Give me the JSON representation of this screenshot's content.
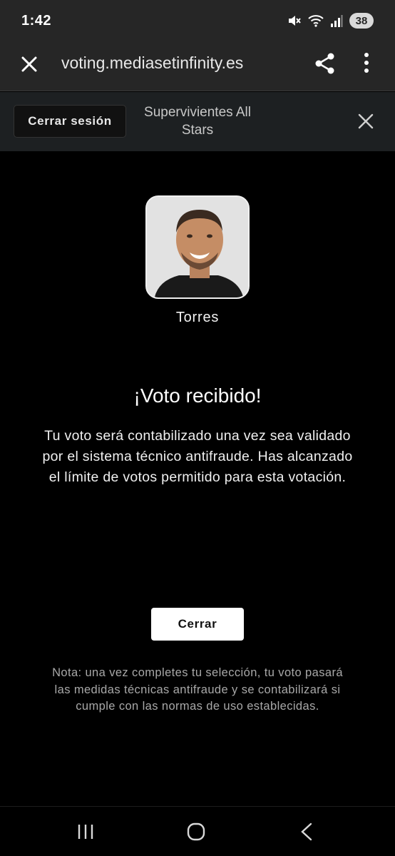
{
  "status_bar": {
    "time": "1:42",
    "icons": [
      "mute-icon",
      "wifi-icon",
      "signal-icon"
    ],
    "battery": "38"
  },
  "browser": {
    "url": "voting.mediasetinfinity.es",
    "icons": [
      "close-icon",
      "share-icon",
      "more-vert-icon"
    ]
  },
  "site_header": {
    "logout_label": "Cerrar sesión",
    "title": "Supervivientes All Stars"
  },
  "contestant": {
    "name": "Torres"
  },
  "result": {
    "title": "¡Voto recibido!",
    "message": "Tu voto será contabilizado una vez sea validado por el sistema técnico antifraude. Has alcanzado el límite de votos permitido para esta votación.",
    "close_label": "Cerrar",
    "note": "Nota: una vez completes tu selección, tu voto pasará las medidas técnicas antifraude y se contabilizará si cumple con las normas de uso establecidas."
  },
  "nav_bar": {
    "icons": [
      "recents-icon",
      "home-icon",
      "back-icon"
    ]
  },
  "colors": {
    "background": "#000000",
    "bar": "#262626",
    "header": "#1d2022",
    "button_bg": "#ffffff"
  }
}
